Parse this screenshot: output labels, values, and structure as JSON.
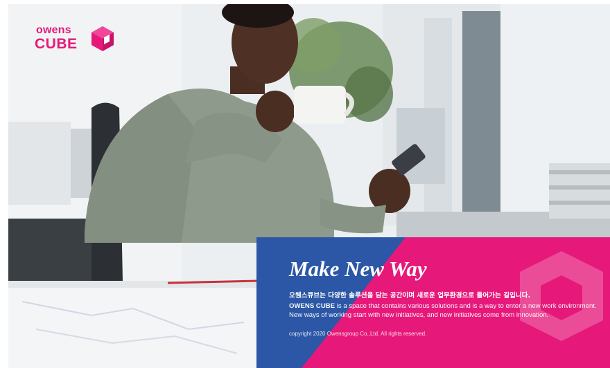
{
  "brand": {
    "logo_line1": "owens",
    "logo_line2": "CUBE",
    "color_primary": "#e6197a",
    "color_secondary": "#2b57a6"
  },
  "hero_image": {
    "icon": "person-with-coffee-and-phone-photo"
  },
  "panel": {
    "headline": "Make New Way",
    "korean_text": "오웬스큐브는 다양한 솔루션을 담는 공간이며 새로운 업무환경으로 들어가는 길입니다.",
    "english_brand": "OWENS CUBE",
    "english_text": " is a space that contains various solutions and is a way to enter a new work environment. New ways of working start with new initiatives, and new initiatives come from innovation.",
    "copyright": "copyright 2020 Owensgroup Co.,Ltd. All rights reserved.",
    "colors": {
      "blue": "#2b57a6",
      "pink": "#e6197a"
    }
  }
}
